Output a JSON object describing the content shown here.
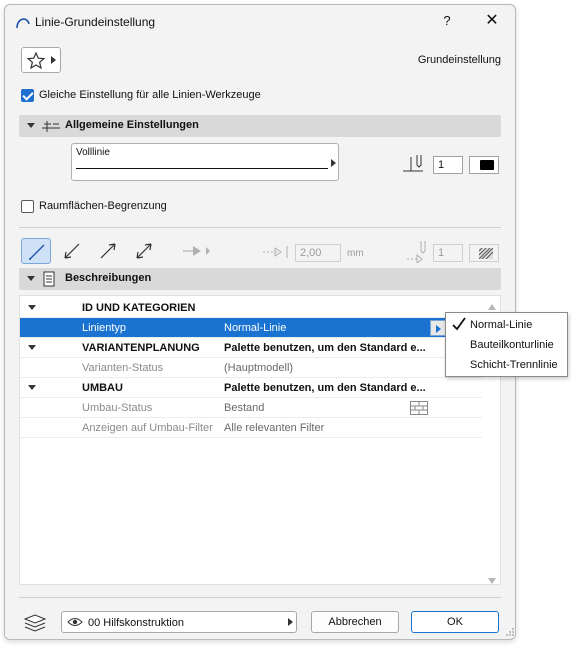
{
  "window": {
    "title": "Linie-Grundeinstellung",
    "help_label": "?",
    "close_label": "✕"
  },
  "header": {
    "favorites_icon": "star-icon",
    "preset_name": "Grundeinstellung"
  },
  "same_settings": {
    "label": "Gleiche Einstellung für alle Linien-Werkzeuge",
    "checked": true
  },
  "general": {
    "title": "Allgemeine Einstellungen",
    "linetype_name": "Volllinie",
    "pen_number": "1",
    "pen_color": "#000000"
  },
  "room_boundary": {
    "label": "Raumflächen-Begrenzung",
    "checked": false
  },
  "geometry": {
    "angle_value": "2,00",
    "angle_unit": "mm",
    "arrow_pen": "1"
  },
  "descriptions": {
    "title": "Beschreibungen",
    "rows": [
      {
        "type": "group",
        "name": "ID UND KATEGORIEN",
        "value": ""
      },
      {
        "type": "item",
        "name": "Linientyp",
        "value": "Normal-Linie",
        "selected": true
      },
      {
        "type": "group",
        "name": "VARIANTENPLANUNG",
        "value": "Palette benutzen, um den Standard e..."
      },
      {
        "type": "item",
        "name": "Varianten-Status",
        "value": "(Hauptmodell)"
      },
      {
        "type": "group",
        "name": "UMBAU",
        "value": "Palette benutzen, um den Standard e..."
      },
      {
        "type": "item",
        "name": "Umbau-Status",
        "value": "Bestand"
      },
      {
        "type": "item",
        "name": "Anzeigen auf Umbau-Filter",
        "value": "Alle relevanten Filter"
      }
    ]
  },
  "popup": {
    "items": [
      {
        "label": "Normal-Linie",
        "checked": true
      },
      {
        "label": "Bauteilkonturlinie",
        "checked": false
      },
      {
        "label": "Schicht-Trennlinie",
        "checked": false
      }
    ]
  },
  "footer": {
    "layer_name": "00 Hilfskonstruktion",
    "cancel_label": "Abbrechen",
    "ok_label": "OK"
  },
  "colors": {
    "accent": "#1a73d1",
    "section_bg": "#d9d9d9"
  }
}
